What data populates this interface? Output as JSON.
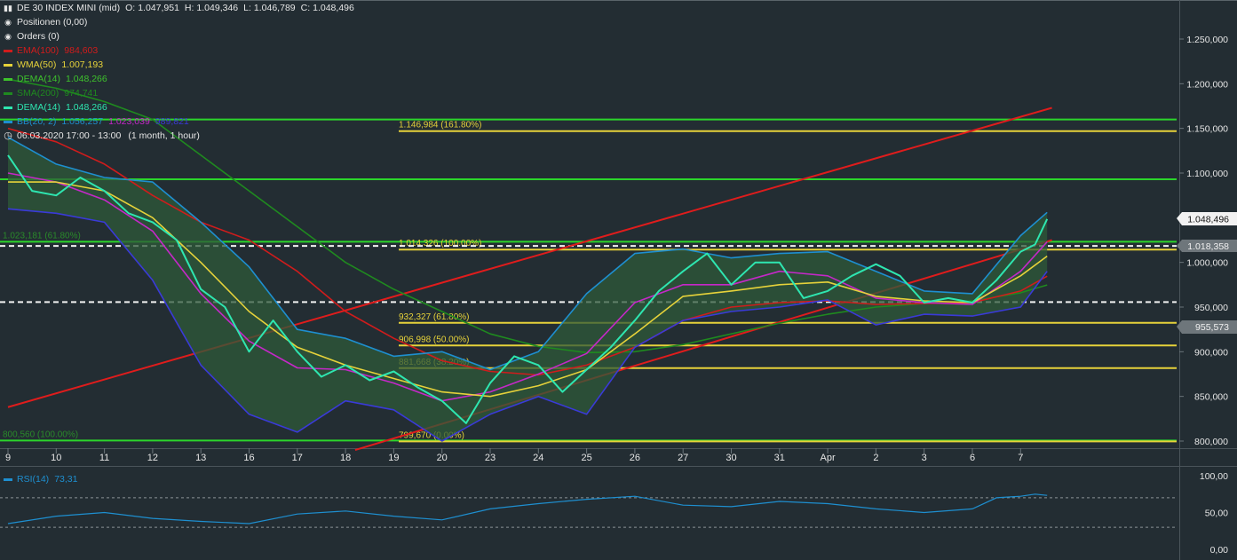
{
  "header": {
    "title": "DE 30 INDEX MINI (mid)",
    "o_label": "O:",
    "o": "1.047,951",
    "h_label": "H:",
    "h": "1.049,346",
    "l_label": "L:",
    "l": "1.046,789",
    "c_label": "C:",
    "c": "1.048,496"
  },
  "legend": {
    "positions": "Positionen (0,00)",
    "orders": "Orders (0)",
    "ema": {
      "label": "EMA(100)",
      "value": "984,603",
      "color": "#d01c1c"
    },
    "wma": {
      "label": "WMA(50)",
      "value": "1.007,193",
      "color": "#e6d23a"
    },
    "dema1": {
      "label": "DEMA(14)",
      "value": "1.048,266",
      "color": "#3ec32c"
    },
    "sma": {
      "label": "SMA(200)",
      "value": "974,741",
      "color": "#1f8a1f"
    },
    "dema2": {
      "label": "DEMA(14)",
      "value": "1.048,266",
      "color": "#2ee6b0"
    },
    "bb": {
      "label": "BB(20, 2)",
      "v1": "1.056,257",
      "v2": "1.023,039",
      "v3": "989,821",
      "color": "#1e8fd0",
      "c2": "#c528c8",
      "c3": "#3a3ad8"
    },
    "time": "06.03.2020 17:00 - 13:00",
    "interval": "(1 month, 1 hour)"
  },
  "price_tags": {
    "last": "1.048,496",
    "tag2": "1.018,358",
    "tag3": "955,573"
  },
  "rsi": {
    "label": "RSI(14)",
    "value": "73,31",
    "color": "#1e8fd0"
  },
  "chart_data": {
    "type": "line",
    "title": "DE 30 INDEX MINI (mid)",
    "x_ticks": [
      "9",
      "10",
      "11",
      "12",
      "13",
      "16",
      "17",
      "18",
      "19",
      "20",
      "23",
      "24",
      "25",
      "26",
      "27",
      "30",
      "31",
      "Apr",
      "2",
      "3",
      "6",
      "7"
    ],
    "y_ticks": [
      "800,000",
      "850,000",
      "900,000",
      "950,000",
      "1.000,000",
      "1.050,000",
      "1.100,000",
      "1.150,000",
      "1.200,000",
      "1.250,000"
    ],
    "ylim": [
      785,
      1265
    ],
    "rsi_ticks": [
      "0,00",
      "50,00",
      "100,00"
    ],
    "rsi_levels": [
      30,
      70
    ],
    "horizontal_levels": [
      {
        "value": 800.56,
        "color": "#2bd62b",
        "label": "800,560 (100.00%)"
      },
      {
        "value": 1023.18,
        "color": "#2bd62b",
        "label": "1.023,181 (61.80%)"
      },
      {
        "value": 1093.0,
        "color": "#2bd62b",
        "label": ""
      },
      {
        "value": 1160.0,
        "color": "#2bd62b",
        "label": ""
      },
      {
        "value": 799.67,
        "color": "#e6d23a",
        "label": "799,670 (0.00%)"
      },
      {
        "value": 881.668,
        "color": "#e6d23a",
        "label": "881,668 (38.20%)"
      },
      {
        "value": 906.998,
        "color": "#e6d23a",
        "label": "906,998 (50.00%)"
      },
      {
        "value": 932.327,
        "color": "#e6d23a",
        "label": "932,327 (61.80%)"
      },
      {
        "value": 1014.326,
        "color": "#e6d23a",
        "label": "1.014,326 (100.00%)"
      },
      {
        "value": 1146.984,
        "color": "#e6d23a",
        "label": "1.146,984 (161.80%)"
      }
    ],
    "dashed_levels": [
      1018.358,
      955.573
    ],
    "trendlines": [
      {
        "x": [
          0,
          21.65
        ],
        "y": [
          838,
          1173
        ],
        "color": "#e01c1c"
      },
      {
        "x": [
          7.2,
          21.65
        ],
        "y": [
          790,
          1025
        ],
        "color": "#e01c1c"
      }
    ],
    "series": [
      {
        "name": "price",
        "color": "#2ee6b0",
        "x": [
          0,
          0.5,
          1,
          1.5,
          2,
          2.5,
          3,
          3.5,
          4,
          4.5,
          5,
          5.5,
          6,
          6.5,
          7,
          7.5,
          8,
          8.5,
          9,
          9.5,
          10,
          10.5,
          11,
          11.5,
          12,
          12.5,
          13,
          13.5,
          14,
          14.5,
          15,
          15.5,
          16,
          16.5,
          17,
          17.5,
          18,
          18.5,
          19,
          19.5,
          20,
          20.5,
          21,
          21.3,
          21.55
        ],
        "y": [
          1120,
          1080,
          1075,
          1095,
          1080,
          1055,
          1045,
          1025,
          970,
          950,
          900,
          935,
          900,
          872,
          885,
          868,
          878,
          860,
          845,
          820,
          865,
          895,
          885,
          855,
          880,
          905,
          935,
          968,
          990,
          1010,
          975,
          1000,
          1000,
          960,
          968,
          985,
          998,
          985,
          955,
          960,
          955,
          980,
          1012,
          1020,
          1048.5
        ]
      },
      {
        "name": "WMA(50)",
        "color": "#e6d23a",
        "x": [
          0,
          1,
          2,
          3,
          4,
          5,
          6,
          7,
          8,
          9,
          10,
          11,
          12,
          13,
          14,
          15,
          16,
          17,
          18,
          19,
          20,
          21,
          21.55
        ],
        "y": [
          1090,
          1090,
          1080,
          1050,
          1000,
          945,
          905,
          885,
          870,
          855,
          850,
          862,
          880,
          920,
          962,
          968,
          975,
          978,
          962,
          957,
          955,
          985,
          1007
        ]
      },
      {
        "name": "EMA(100)",
        "color": "#d01c1c",
        "x": [
          0,
          1,
          2,
          3,
          4,
          5,
          6,
          7,
          8,
          9,
          10,
          11,
          12,
          13,
          14,
          15,
          16,
          17,
          18,
          19,
          20,
          21,
          21.55
        ],
        "y": [
          1150,
          1135,
          1110,
          1075,
          1045,
          1025,
          990,
          945,
          915,
          890,
          878,
          874,
          885,
          905,
          935,
          950,
          955,
          957,
          953,
          954,
          955,
          968,
          984.6
        ]
      },
      {
        "name": "SMA(200)",
        "color": "#1f8a1f",
        "x": [
          0,
          1,
          2,
          3,
          4,
          5,
          6,
          7,
          8,
          9,
          10,
          11,
          12,
          13,
          14,
          15,
          16,
          17,
          18,
          19,
          20,
          21,
          21.55
        ],
        "y": [
          1205,
          1195,
          1180,
          1160,
          1120,
          1080,
          1040,
          1000,
          970,
          945,
          920,
          906,
          899,
          900,
          908,
          920,
          932,
          942,
          950,
          954,
          957,
          966,
          974.7
        ]
      },
      {
        "name": "BB middle",
        "color": "#c528c8",
        "x": [
          0,
          1,
          2,
          3,
          4,
          5,
          6,
          7,
          8,
          9,
          10,
          11,
          12,
          13,
          14,
          15,
          16,
          17,
          18,
          19,
          20,
          21,
          21.55
        ],
        "y": [
          1100,
          1090,
          1070,
          1035,
          965,
          912,
          882,
          880,
          865,
          845,
          855,
          875,
          898,
          955,
          975,
          975,
          990,
          985,
          960,
          955,
          953,
          990,
          1023
        ]
      },
      {
        "name": "BB upper",
        "color": "#1e8fd0",
        "x": [
          0,
          1,
          2,
          3,
          4,
          5,
          6,
          7,
          8,
          9,
          10,
          11,
          12,
          13,
          14,
          15,
          16,
          17,
          18,
          19,
          20,
          21,
          21.55
        ],
        "y": [
          1140,
          1110,
          1095,
          1090,
          1045,
          995,
          925,
          915,
          895,
          900,
          880,
          900,
          965,
          1010,
          1015,
          1005,
          1010,
          1012,
          990,
          968,
          965,
          1030,
          1056
        ]
      },
      {
        "name": "BB lower",
        "color": "#3a3ad8",
        "x": [
          0,
          1,
          2,
          3,
          4,
          5,
          6,
          7,
          8,
          9,
          10,
          11,
          12,
          13,
          14,
          15,
          16,
          17,
          18,
          19,
          20,
          21,
          21.55
        ],
        "y": [
          1060,
          1055,
          1045,
          980,
          885,
          830,
          810,
          845,
          835,
          800,
          830,
          850,
          830,
          905,
          935,
          945,
          950,
          958,
          930,
          942,
          940,
          950,
          990
        ]
      },
      {
        "name": "RSI(14)",
        "color": "#1e8fd0",
        "x": [
          0,
          1,
          2,
          3,
          4,
          5,
          6,
          7,
          8,
          9,
          10,
          11,
          12,
          13,
          14,
          15,
          16,
          17,
          18,
          19,
          20,
          20.5,
          21,
          21.3,
          21.55
        ],
        "y": [
          35,
          45,
          50,
          42,
          38,
          35,
          48,
          52,
          45,
          40,
          55,
          62,
          68,
          72,
          60,
          58,
          65,
          62,
          55,
          50,
          55,
          70,
          72,
          75,
          73.31
        ]
      }
    ]
  }
}
